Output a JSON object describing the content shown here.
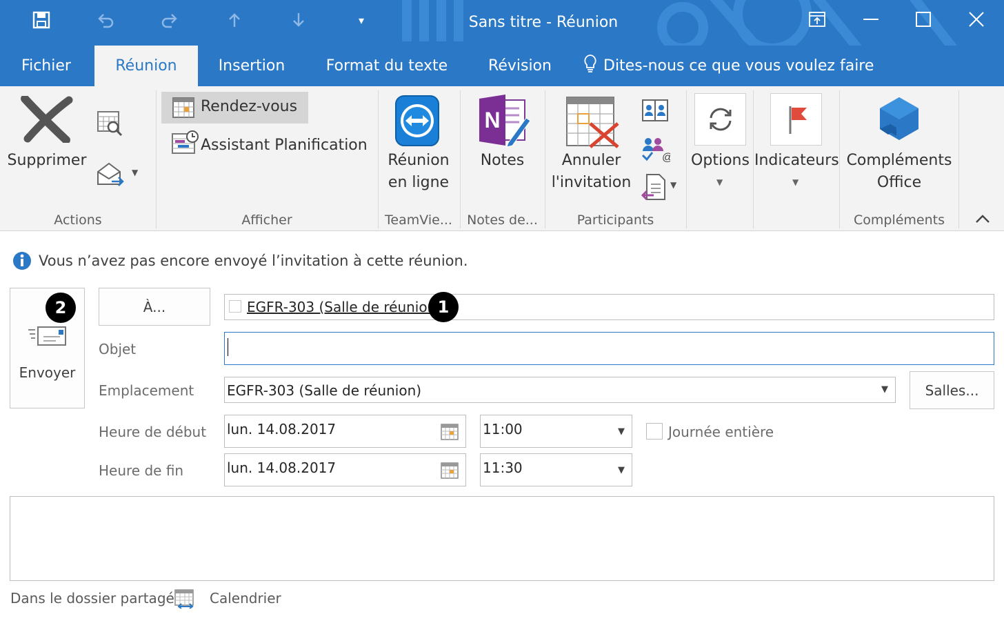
{
  "window": {
    "title": "Sans titre - Réunion"
  },
  "qat": {
    "save": "save-icon",
    "undo": "undo-icon",
    "redo": "redo-icon",
    "up": "up-arrow-icon",
    "down": "down-arrow-icon",
    "customize": "▾"
  },
  "tabs": [
    {
      "label": "Fichier"
    },
    {
      "label": "Réunion"
    },
    {
      "label": "Insertion"
    },
    {
      "label": "Format du texte"
    },
    {
      "label": "Révision"
    }
  ],
  "tell_me": "Dites-nous ce que vous voulez faire",
  "ribbon": {
    "supprimer": "Supprimer",
    "rendezvous": "Rendez-vous",
    "assistant": "Assistant Planification",
    "reunion_en_ligne_1": "Réunion",
    "reunion_en_ligne_2": "en ligne",
    "notes": "Notes",
    "annuler_1": "Annuler",
    "annuler_2": "l'invitation",
    "options": "Options",
    "indicateurs": "Indicateurs",
    "complements_1": "Compléments",
    "complements_2": "Office",
    "groups": {
      "actions": "Actions",
      "afficher": "Afficher",
      "teamviewer": "TeamVie...",
      "notes": "Notes de...",
      "participants": "Participants",
      "complements": "Compléments"
    }
  },
  "info": "Vous n’avez pas encore envoyé l’invitation à cette réunion.",
  "form": {
    "send": "Envoyer",
    "to_button": "À...",
    "attendee": "EGFR-303 (Salle de réunion)",
    "subject_label": "Objet",
    "subject_value": "",
    "location_label": "Emplacement",
    "location_value": "EGFR-303 (Salle de réunion)",
    "rooms_button": "Salles...",
    "start_label": "Heure de début",
    "start_date": "lun. 14.08.2017",
    "start_time": "11:00",
    "end_label": "Heure de fin",
    "end_date": "lun. 14.08.2017",
    "end_time": "11:30",
    "all_day": "Journée entière",
    "badge1": "1",
    "badge2": "2"
  },
  "footer": {
    "folder": "Dans le dossier partagé",
    "calendar": "Calendrier"
  },
  "colors": {
    "accent": "#2b79c6",
    "ribbon_bg": "#f3f3f3",
    "delete_icon": "#555555",
    "cancel_x": "#d9432f",
    "flag": "#e04b3c"
  }
}
